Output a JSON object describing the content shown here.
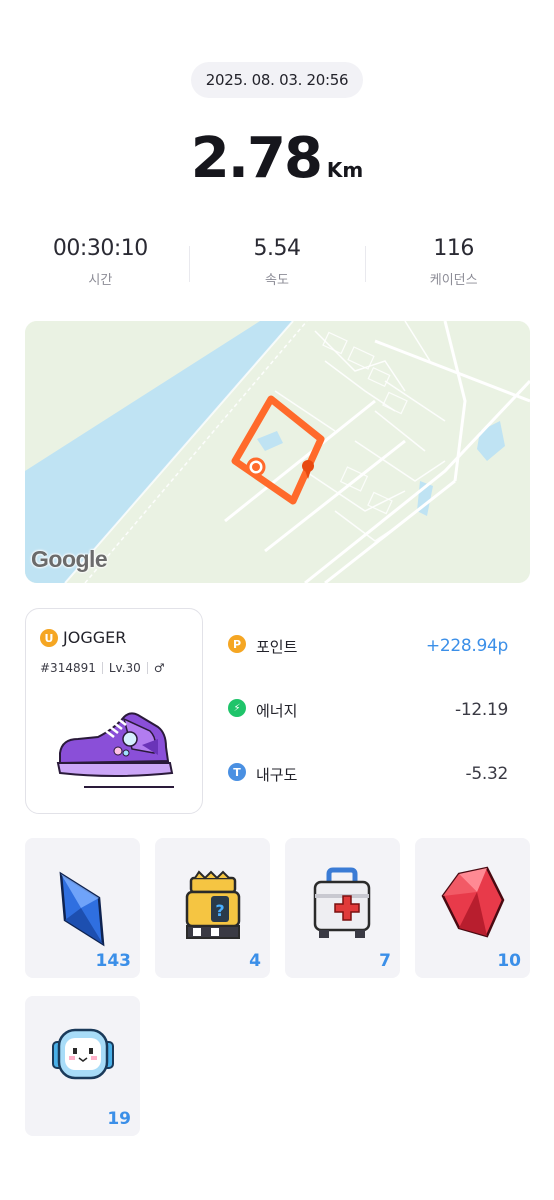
{
  "header": {
    "datetime": "2025. 08. 03. 20:56"
  },
  "distance": {
    "value": "2.78",
    "unit": "Km"
  },
  "stats": [
    {
      "value": "00:30:10",
      "label": "시간"
    },
    {
      "value": "5.54",
      "label": "속도"
    },
    {
      "value": "116",
      "label": "케이던스"
    }
  ],
  "map": {
    "attribution": "Google"
  },
  "shoe": {
    "badge": "U",
    "name": "JOGGER",
    "id": "#314891",
    "level": "Lv.30",
    "gender": "♂"
  },
  "rewards": [
    {
      "icon": "point-icon",
      "symbol": "P",
      "label": "포인트",
      "value": "+228.94p",
      "color": "#f5a623"
    },
    {
      "icon": "energy-icon",
      "symbol": "⚡",
      "label": "에너지",
      "value": "-12.19",
      "color": "#1fc46a"
    },
    {
      "icon": "durability-icon",
      "symbol": "T",
      "label": "내구도",
      "value": "-5.32",
      "color": "#4a90e2"
    }
  ],
  "items": [
    {
      "name": "blue-gem",
      "count": "143"
    },
    {
      "name": "mystery-box",
      "count": "4"
    },
    {
      "name": "repair-kit",
      "count": "7"
    },
    {
      "name": "red-gem",
      "count": "10"
    },
    {
      "name": "mascot",
      "count": "19"
    }
  ]
}
